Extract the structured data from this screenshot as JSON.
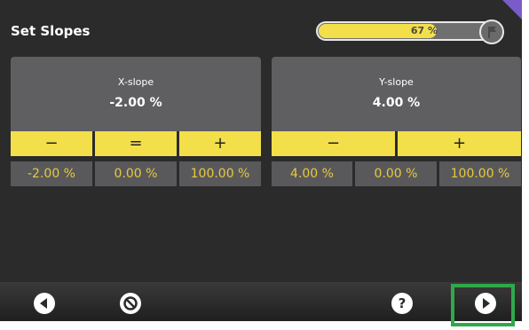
{
  "header": {
    "title": "Set Slopes",
    "progress_text": "67 %",
    "progress_fraction": 0.67
  },
  "x_slope": {
    "label": "X-slope",
    "value": "-2.00 %",
    "buttons": {
      "minus": "−",
      "equals": "=",
      "plus": "+"
    },
    "presets": [
      "-2.00 %",
      "0.00 %",
      "100.00 %"
    ]
  },
  "y_slope": {
    "label": "Y-slope",
    "value": "4.00 %",
    "buttons": {
      "minus": "−",
      "plus": "+"
    },
    "presets": [
      "4.00 %",
      "0.00 %",
      "100.00 %"
    ]
  },
  "footer": {
    "icons": [
      "back-icon",
      "cancel-icon",
      "help-icon",
      "next-icon"
    ],
    "help_glyph": "?"
  },
  "colors": {
    "accent_yellow": "#f3df4a",
    "value_text": "#e8c93b",
    "highlight_green": "#2fa94a",
    "corner_purple": "#7a5cc8"
  }
}
